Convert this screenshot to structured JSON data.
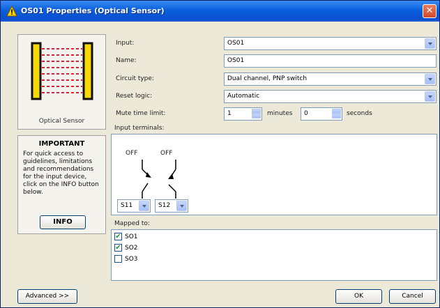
{
  "window": {
    "title": "OS01 Properties (Optical Sensor)",
    "close_glyph": "✕"
  },
  "device": {
    "caption": "Optical Sensor"
  },
  "important": {
    "title": "IMPORTANT",
    "text": "For quick access to guidelines, limitations and recommendations for the input device, click on the INFO button below.",
    "info_label": "INFO"
  },
  "form": {
    "input_label": "Input:",
    "input_value": "OS01",
    "name_label": "Name:",
    "name_value": "OS01",
    "circuit_label": "Circuit type:",
    "circuit_value": "Dual channel, PNP switch",
    "reset_label": "Reset logic:",
    "reset_value": "Automatic",
    "mute_label": "Mute time limit:",
    "mute_minutes": "1",
    "minutes_label": "minutes",
    "mute_seconds": "0",
    "seconds_label": "seconds",
    "terminals_label": "Input terminals:",
    "mapped_label": "Mapped to:"
  },
  "terminals": [
    {
      "state": "OFF",
      "select": "S11"
    },
    {
      "state": "OFF",
      "select": "S12"
    }
  ],
  "mapped": [
    {
      "label": "SO1",
      "checked": true
    },
    {
      "label": "SO2",
      "checked": true
    },
    {
      "label": "SO3",
      "checked": false
    }
  ],
  "buttons": {
    "advanced": "Advanced >>",
    "ok": "OK",
    "cancel": "Cancel"
  },
  "colors": {
    "titlebar": "#0a5fdc",
    "dialog_bg": "#ece9d8",
    "sensor_bar": "#f5d90a",
    "beam": "#e0203a"
  }
}
